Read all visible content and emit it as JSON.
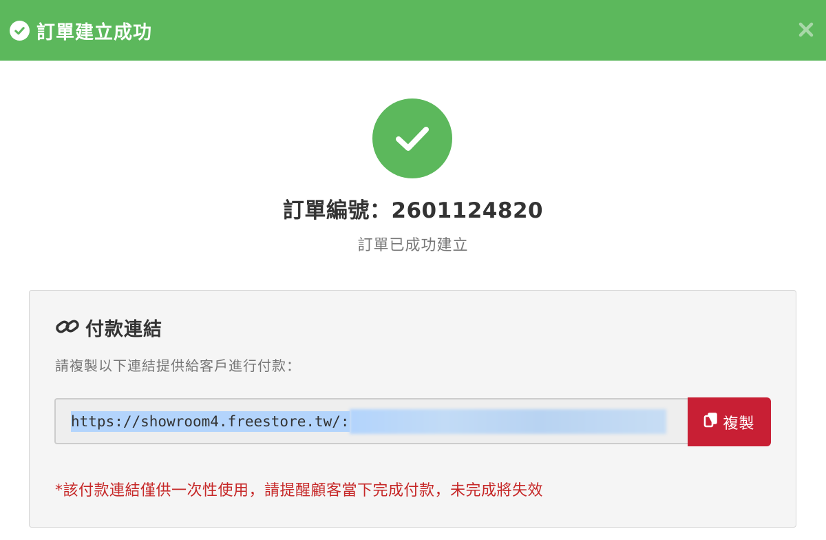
{
  "header": {
    "title": "訂單建立成功",
    "close_symbol": "×",
    "color": "#5cb85c"
  },
  "order": {
    "number_label": "訂單編號：2601124820",
    "status": "訂單已成功建立"
  },
  "payment_link": {
    "title": "付款連結",
    "instruction": "請複製以下連結提供給客戶進行付款：",
    "url": "https://showroom4.freestore.tw/:",
    "copy_button_label": "複製",
    "warning": "*該付款連結僅供一次性使用，請提醒顧客當下完成付款，未完成將失效",
    "copy_button_color": "#c81f34",
    "warning_color": "#c62828"
  },
  "icons": {
    "header": "check-circle-icon",
    "close": "close-icon",
    "success": "check-circle-icon",
    "link": "link-icon",
    "copy": "copy-icon"
  }
}
